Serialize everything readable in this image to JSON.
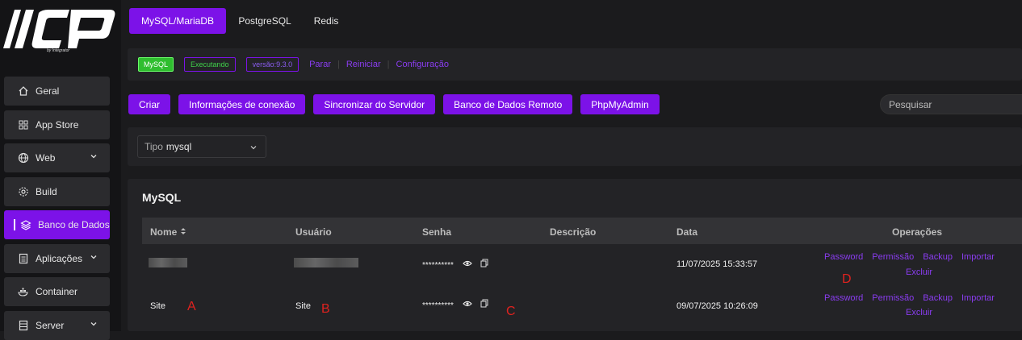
{
  "logo": {
    "text": "/ICP",
    "subtext": "by Integrator"
  },
  "sidebar": {
    "items": [
      {
        "label": "Geral",
        "icon": "home-icon"
      },
      {
        "label": "App Store",
        "icon": "grid-icon"
      },
      {
        "label": "Web",
        "icon": "globe-icon"
      },
      {
        "label": "Build",
        "icon": "gear-icon"
      },
      {
        "label": "Banco de Dados",
        "icon": "layers-icon"
      },
      {
        "label": "Aplicações",
        "icon": "document-icon"
      },
      {
        "label": "Container",
        "icon": "docker-icon"
      },
      {
        "label": "Server",
        "icon": "server-icon"
      }
    ]
  },
  "tabs": [
    {
      "label": "MySQL/MariaDB",
      "active": true
    },
    {
      "label": "PostgreSQL",
      "active": false
    },
    {
      "label": "Redis",
      "active": false
    }
  ],
  "status": {
    "engine": "MySQL",
    "state": "Executando",
    "version": "versão:9.3.0",
    "actions": [
      "Parar",
      "Reiniciar",
      "Configuração"
    ]
  },
  "toolbar": {
    "buttons": [
      "Criar",
      "Informações de conexão",
      "Sincronizar do Servidor",
      "Banco de Dados Remoto",
      "PhpMyAdmin"
    ],
    "search_placeholder": "Pesquisar"
  },
  "filter": {
    "label": "Tipo",
    "value": "mysql"
  },
  "table": {
    "title": "MySQL",
    "columns": [
      "Nome",
      "Usuário",
      "Senha",
      "Descrição",
      "Data",
      "Operações"
    ],
    "rows": [
      {
        "name": "",
        "user": "",
        "password": "**********",
        "description": "",
        "date": "11/07/2025 15:33:57"
      },
      {
        "name": "Site",
        "user": "Site",
        "password": "**********",
        "description": "",
        "date": "09/07/2025 10:26:09"
      }
    ],
    "operations": [
      "Password",
      "Permissão",
      "Backup",
      "Importar",
      "Excluir"
    ]
  },
  "markers": [
    "A",
    "B",
    "C",
    "D"
  ],
  "colors": {
    "accent": "#7c12e8",
    "running": "#2fbe2f",
    "annotation": "#e0221f"
  }
}
